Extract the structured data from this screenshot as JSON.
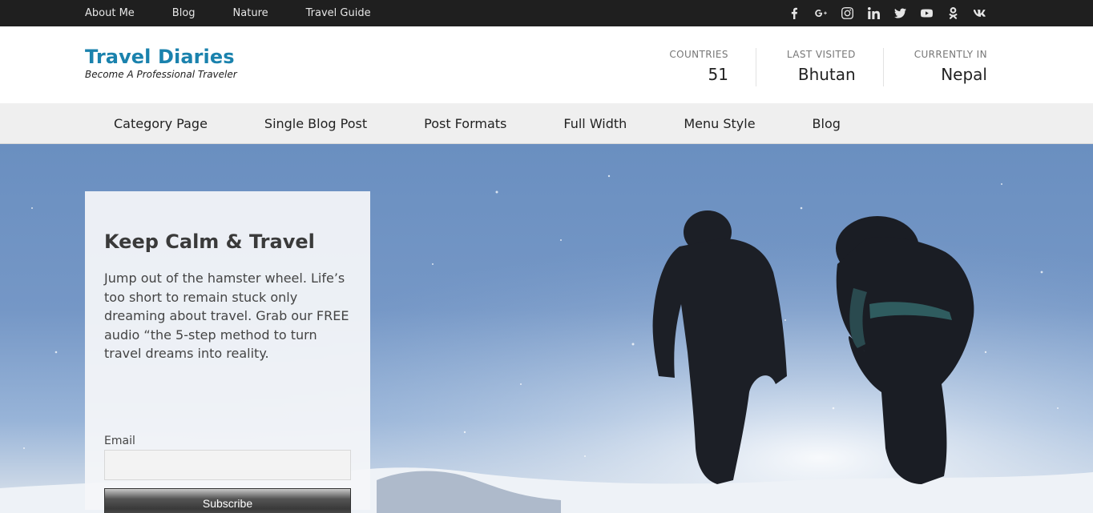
{
  "topbar": {
    "links": [
      "About Me",
      "Blog",
      "Nature",
      "Travel Guide"
    ],
    "social_icons": [
      "facebook-icon",
      "google-plus-icon",
      "instagram-icon",
      "linkedin-icon",
      "twitter-icon",
      "youtube-icon",
      "odnoklassniki-icon",
      "vk-icon"
    ]
  },
  "brand": {
    "title": "Travel Diaries",
    "tagline": "Become A Professional Traveler",
    "color": "#1a82ad"
  },
  "stats": [
    {
      "label": "COUNTRIES",
      "value": "51"
    },
    {
      "label": "LAST VISITED",
      "value": "Bhutan"
    },
    {
      "label": "CURRENTLY IN",
      "value": "Nepal"
    }
  ],
  "mainnav": [
    "Category Page",
    "Single Blog Post",
    "Post Formats",
    "Full Width",
    "Menu Style",
    "Blog"
  ],
  "hero": {
    "card": {
      "title": "Keep Calm & Travel",
      "body": "Jump out of the hamster wheel. Life’s too short to remain stuck only dreaming about travel. Grab our FREE audio “the 5-step method to turn travel dreams into reality.",
      "email_label": "Email",
      "email_value": "",
      "subscribe_label": "Subscribe"
    }
  }
}
